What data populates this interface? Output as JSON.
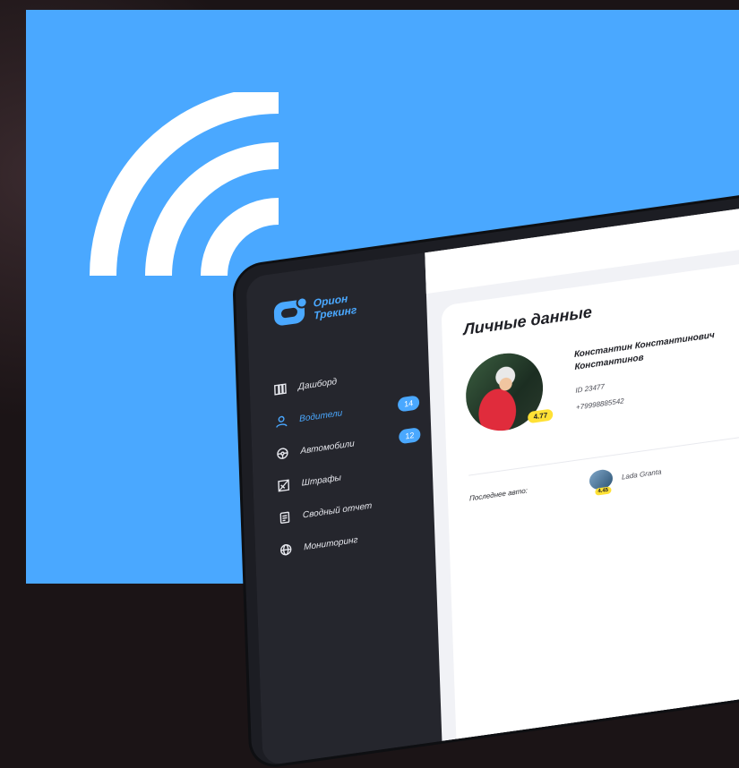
{
  "brand": {
    "line1": "Орион",
    "line2": "Трекинг",
    "accent_color": "#4aa8ff",
    "background_color": "#4aa8ff",
    "icon": "wifi-signal-icon"
  },
  "sidebar": {
    "items": [
      {
        "label": "Дашборд",
        "icon": "dashboard-icon",
        "badge": null,
        "active": false
      },
      {
        "label": "Водители",
        "icon": "user-icon",
        "badge": "14",
        "active": true
      },
      {
        "label": "Автомобили",
        "icon": "steering-wheel-icon",
        "badge": "12",
        "active": false
      },
      {
        "label": "Штрафы",
        "icon": "fines-icon",
        "badge": null,
        "active": false
      },
      {
        "label": "Сводный отчет",
        "icon": "report-icon",
        "badge": null,
        "active": false
      },
      {
        "label": "Мониторинг",
        "icon": "globe-icon",
        "badge": null,
        "active": false
      }
    ]
  },
  "profile": {
    "section_title": "Личные данные",
    "name": "Константин Константинович Константинов",
    "id": "ID 23477",
    "phone": "+79998885542",
    "rating": "4.77"
  },
  "last_car": {
    "label": "Последнее авто:",
    "name": "Lada Granta",
    "rating": "4.45"
  }
}
